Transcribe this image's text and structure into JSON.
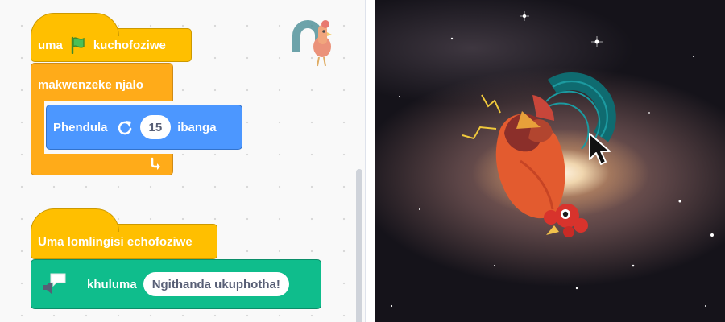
{
  "script_one": {
    "hat_before_flag": "uma",
    "hat_after_flag": "kuchofoziwe",
    "forever_label": "makwenzeke njalo",
    "turn_label": "Phendula",
    "turn_value": "15",
    "turn_unit": "ibanga"
  },
  "script_two": {
    "hat_label": "Uma lomlingisi echofoziwe",
    "say_label": "khuluma",
    "say_value": "Ngithanda ukuphotha!"
  },
  "icons": {
    "flag": "green-flag-icon",
    "turn": "rotate-right-icon",
    "loop": "loop-arrow-icon",
    "extension": "text-to-speech-icon",
    "sprite": "rooster-sprite-icon",
    "cursor": "mouse-pointer-icon"
  },
  "colors": {
    "events": "#ffbf00",
    "control": "#ffab19",
    "motion": "#4c97ff",
    "extension": "#0fbd8c"
  }
}
